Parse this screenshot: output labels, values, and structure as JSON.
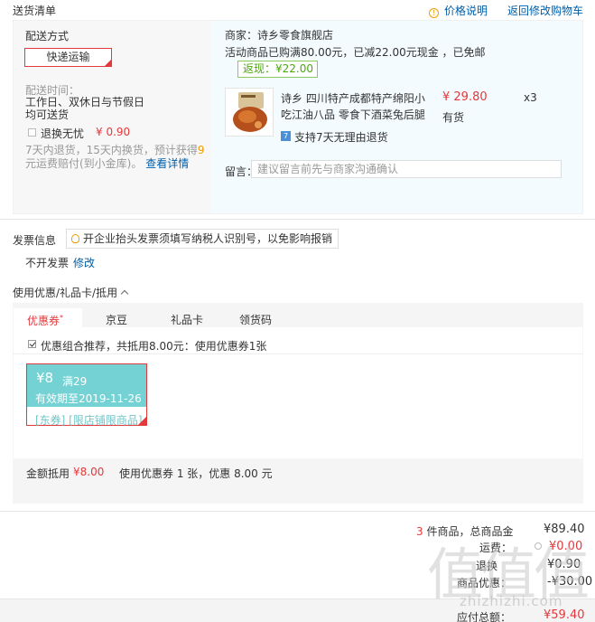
{
  "header": {
    "title": "送货清单",
    "price_note": "价格说明",
    "back_cart": "返回修改购物车"
  },
  "shipping": {
    "method_label": "配送方式",
    "method_value": "快递运输",
    "time_label": "配送时间：",
    "time_line1": "工作日、双休日与节假日",
    "time_line2": "均可送货",
    "return_label": "退换无忧",
    "return_price": "¥ 0.90",
    "return_desc_1a": "7天内退货，15天内换货，预计获得",
    "return_desc_1b": "9",
    "return_desc_2": "元运费赔付(到小金库)。",
    "return_detail_link": "查看详情"
  },
  "store": {
    "merchant": "商家：诗乡零食旗舰店",
    "promo": "活动商品已购满80.00元，已减22.00元现金 ，已免邮",
    "cashback": "返现：¥22.00",
    "product_name_1": "诗乡 四川特产成都特产绵阳小",
    "product_name_2": "吃江油八品 零食下酒菜兔后腿",
    "product_price": "¥ 29.80",
    "product_qty": "x3",
    "product_stock": "有货",
    "seven_day_icon": "7",
    "seven_day": "支持7天无理由退货",
    "note_label": "留言：",
    "note_placeholder": "建议留言前先与商家沟通确认"
  },
  "invoice": {
    "label": "发票信息",
    "tip": "开企业抬头发票须填写纳税人识别号，以免影响报销",
    "value": "不开发票",
    "edit": "修改"
  },
  "coupon": {
    "title": "使用优惠/礼品卡/抵用",
    "tabs": [
      {
        "label": "优惠券",
        "mark": "*"
      },
      {
        "label": "京豆"
      },
      {
        "label": "礼品卡"
      },
      {
        "label": "领货码"
      }
    ],
    "combo_text": "优惠组合推荐，共抵用8.00元：使用优惠券1张",
    "card": {
      "amount": "¥8",
      "condition": "满29",
      "expire": "有效期至2019-11-26",
      "tags": "[东券] [限店铺限商品]"
    },
    "deduct_label": "金额抵用",
    "deduct_value": "¥8.00",
    "deduct_desc": "使用优惠券 1 张，优惠 8.00 元"
  },
  "totals": {
    "count_num": "3",
    "count_text": " 件商品，总商品金",
    "amount": "¥89.40",
    "freight_label": "运费：",
    "freight_value": "¥0.00",
    "return_fee_label": "退换",
    "return_fee_value": "¥0.90",
    "discount_label": "商品优惠：",
    "discount_value": "-¥30.00",
    "pay_label": "应付总额：",
    "pay_value": "¥59.40"
  },
  "watermark": {
    "zh": "值值值",
    "en": "zhizhizhi.com"
  },
  "colors": {
    "accent_red": "#e4393c",
    "link_blue": "#005ea7",
    "cashback_green": "#4ca70d",
    "coupon_teal": "#74d2d4"
  }
}
